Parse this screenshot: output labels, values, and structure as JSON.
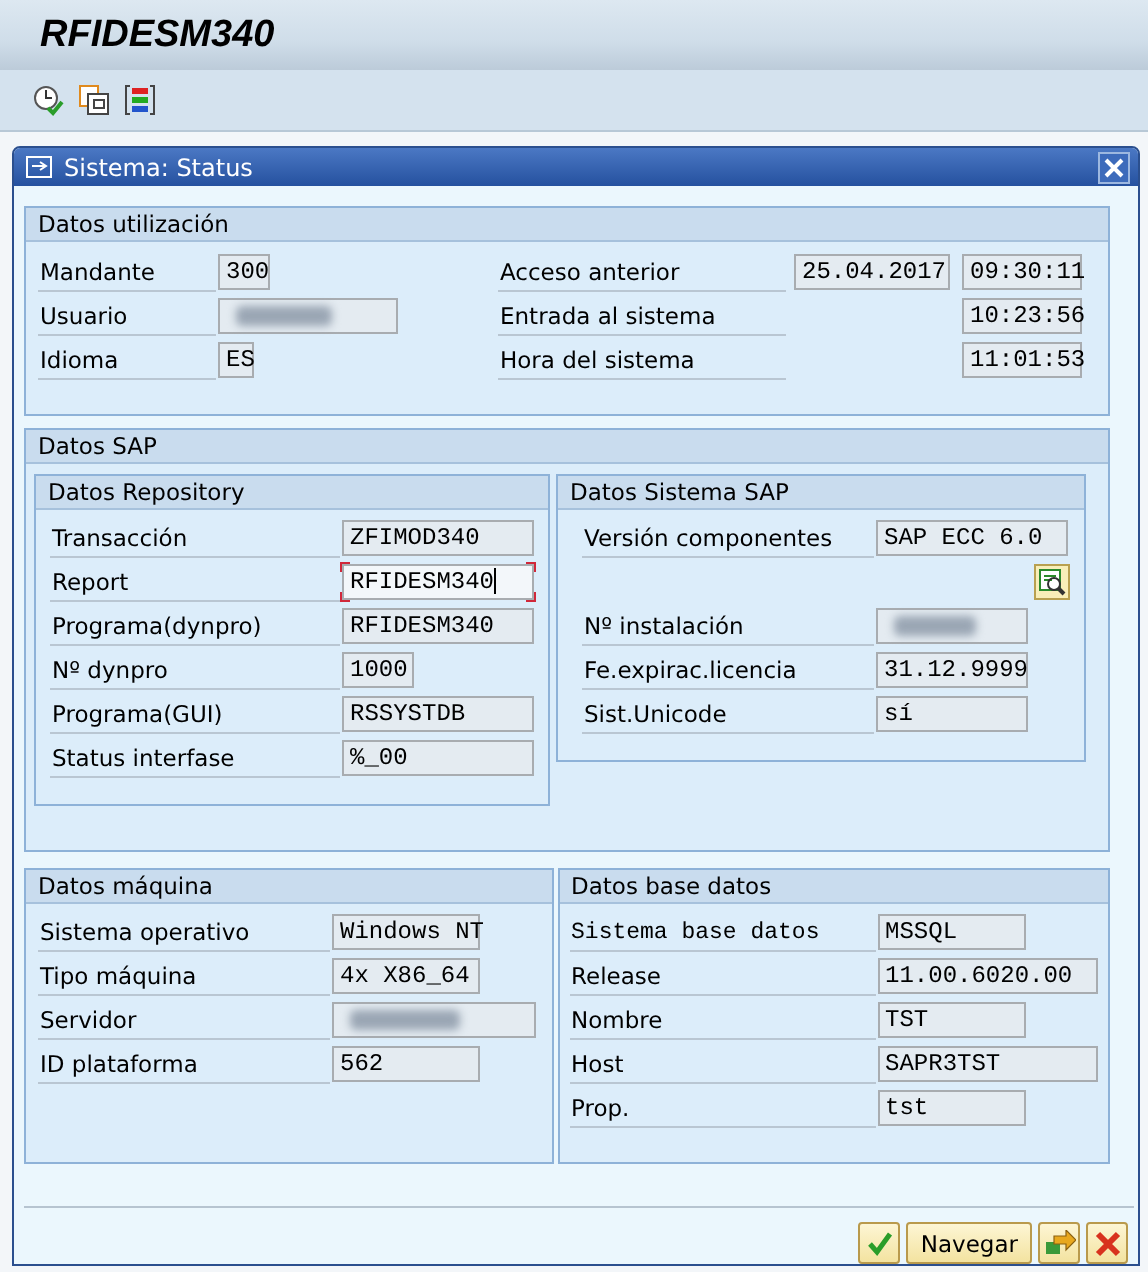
{
  "screen": {
    "title": "RFIDESM340"
  },
  "dialog": {
    "title": "Sistema: Status"
  },
  "usage": {
    "title": "Datos utilización",
    "left": [
      {
        "label": "Mandante",
        "fields": [
          {
            "kind": "text",
            "value": "300"
          }
        ]
      },
      {
        "label": "Usuario",
        "fields": [
          {
            "kind": "redacted"
          }
        ]
      },
      {
        "label": "Idioma",
        "fields": [
          {
            "kind": "text",
            "value": "ES"
          }
        ]
      }
    ],
    "right": [
      {
        "label": "Acceso anterior",
        "fields": [
          {
            "kind": "text",
            "value": "25.04.2017"
          },
          {
            "kind": "text",
            "value": "09:30:11"
          }
        ]
      },
      {
        "label": "Entrada al sistema",
        "fields": [
          {
            "kind": "text",
            "value": "10:23:56"
          }
        ]
      },
      {
        "label": "Hora del sistema",
        "fields": [
          {
            "kind": "text",
            "value": "11:01:53"
          }
        ]
      }
    ]
  },
  "sap": {
    "title": "Datos SAP",
    "repository": {
      "title": "Datos Repository",
      "rows": [
        {
          "label": "Transacción",
          "fields": [
            {
              "kind": "text",
              "value": "ZFIMOD340"
            }
          ]
        },
        {
          "label": "Report",
          "fields": [
            {
              "kind": "focused",
              "value": "RFIDESM340"
            }
          ]
        },
        {
          "label": "Programa(dynpro)",
          "fields": [
            {
              "kind": "text",
              "value": "RFIDESM340"
            }
          ]
        },
        {
          "label": "Nº dynpro",
          "fields": [
            {
              "kind": "text",
              "value": "1000"
            }
          ]
        },
        {
          "label": "Programa(GUI)",
          "fields": [
            {
              "kind": "text",
              "value": "RSSYSTDB"
            }
          ]
        },
        {
          "label": "Status interfase",
          "fields": [
            {
              "kind": "text",
              "value": "%_00"
            }
          ]
        }
      ]
    },
    "system": {
      "title": "Datos Sistema SAP",
      "rows": [
        {
          "kind": "field",
          "label": "Versión componentes",
          "fields": [
            {
              "kind": "text",
              "value": "SAP ECC 6.0"
            }
          ]
        },
        {
          "kind": "button"
        },
        {
          "kind": "field",
          "label": "Nº instalación",
          "fields": [
            {
              "kind": "redacted"
            }
          ]
        },
        {
          "kind": "field",
          "label": "Fe.expirac.licencia",
          "fields": [
            {
              "kind": "text",
              "value": "31.12.9999"
            }
          ]
        },
        {
          "kind": "field",
          "label": "Sist.Unicode",
          "fields": [
            {
              "kind": "text",
              "value": "sí"
            }
          ]
        }
      ]
    }
  },
  "machine": {
    "title": "Datos máquina",
    "rows": [
      {
        "label": "Sistema operativo",
        "fields": [
          {
            "kind": "text",
            "value": "Windows NT"
          }
        ]
      },
      {
        "label": "Tipo máquina",
        "fields": [
          {
            "kind": "text",
            "value": "4x X86_64"
          }
        ]
      },
      {
        "label": "Servidor",
        "fields": [
          {
            "kind": "redacted"
          }
        ]
      },
      {
        "label": "ID plataforma",
        "fields": [
          {
            "kind": "text",
            "value": "562"
          }
        ]
      }
    ]
  },
  "database": {
    "title": "Datos base datos",
    "rows": [
      {
        "mono": true,
        "label": "Sistema base datos",
        "fields": [
          {
            "kind": "text",
            "value": "MSSQL"
          }
        ]
      },
      {
        "mono": false,
        "label": "Release",
        "fields": [
          {
            "kind": "text",
            "value": "11.00.6020.00"
          }
        ]
      },
      {
        "mono": false,
        "label": "Nombre",
        "fields": [
          {
            "kind": "text",
            "value": "TST"
          }
        ]
      },
      {
        "mono": false,
        "label": "Host",
        "fields": [
          {
            "kind": "text",
            "value": "SAPR3TST"
          }
        ]
      },
      {
        "mono": false,
        "label": "Prop.",
        "fields": [
          {
            "kind": "text",
            "value": "tst"
          }
        ]
      }
    ]
  },
  "buttons": [
    {
      "kind": "confirm"
    },
    {
      "kind": "text",
      "label": "Navegar"
    },
    {
      "kind": "forward"
    },
    {
      "kind": "cancel"
    }
  ]
}
